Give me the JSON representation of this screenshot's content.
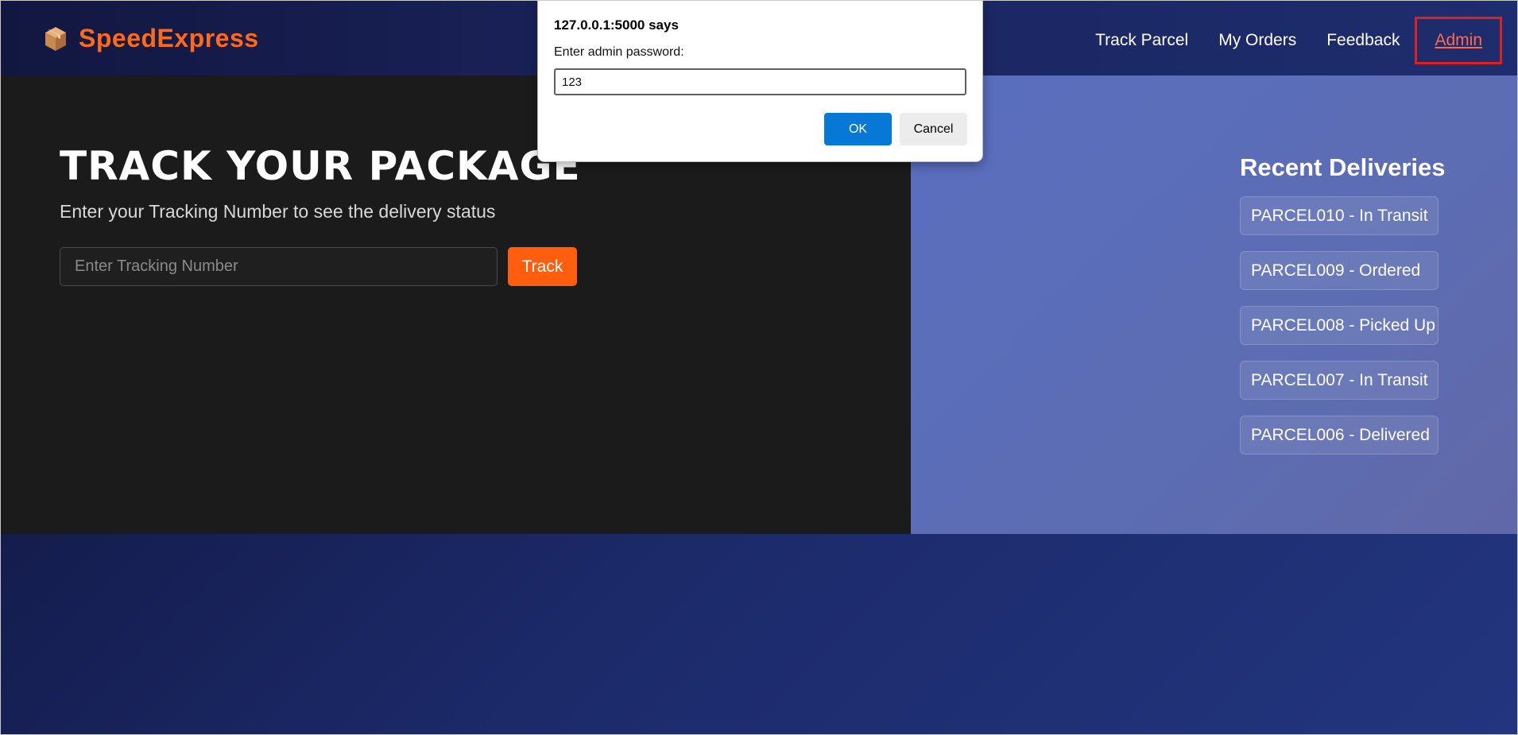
{
  "colors": {
    "brand_orange": "#ff6a1a",
    "track_button": "#ff5e0e",
    "admin_highlight": "#e02020",
    "dialog_ok": "#0778d6"
  },
  "header": {
    "logo_icon": "package-box-icon",
    "brand": "SpeedExpress",
    "nav": {
      "track_parcel": "Track Parcel",
      "my_orders": "My Orders",
      "feedback": "Feedback",
      "admin": "Admin"
    }
  },
  "hero": {
    "title": "TRACK YOUR PACKAGE",
    "subtitle": "Enter your Tracking Number to see the delivery status",
    "input_placeholder": "Enter Tracking Number",
    "track_label": "Track"
  },
  "recent": {
    "title": "Recent Deliveries",
    "items": [
      "PARCEL010 - In Transit",
      "PARCEL009 - Ordered",
      "PARCEL008 - Picked Up",
      "PARCEL007 - In Transit",
      "PARCEL006 - Delivered"
    ]
  },
  "dialog": {
    "title": "127.0.0.1:5000 says",
    "message": "Enter admin password:",
    "input_value": "123",
    "ok_label": "OK",
    "cancel_label": "Cancel"
  }
}
